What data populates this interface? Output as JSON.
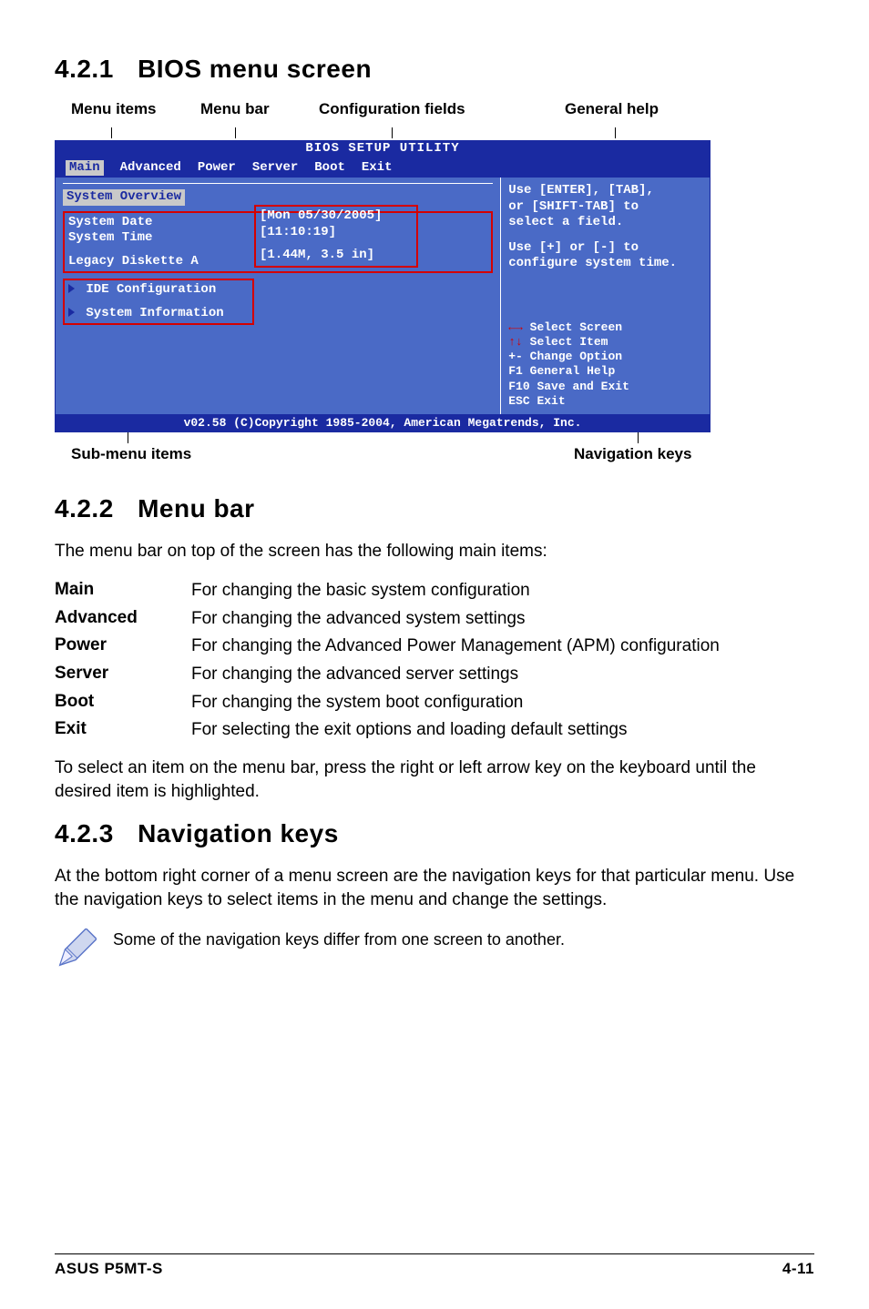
{
  "sections": {
    "s1": {
      "num": "4.2.1",
      "title": "BIOS menu screen"
    },
    "s2": {
      "num": "4.2.2",
      "title": "Menu bar"
    },
    "s3": {
      "num": "4.2.3",
      "title": "Navigation keys"
    }
  },
  "annot": {
    "menu_items": "Menu items",
    "menu_bar": "Menu bar",
    "config_fields": "Configuration fields",
    "general_help": "General help",
    "sub_menu": "Sub-menu items",
    "nav_keys": "Navigation keys"
  },
  "bios": {
    "title": "BIOS SETUP UTILITY",
    "tabs": [
      "Main",
      "Advanced",
      "Power",
      "Server",
      "Boot",
      "Exit"
    ],
    "selected_tab": "Main",
    "overview": "System Overview",
    "fields": {
      "date_label": "System Date",
      "date_value": "[Mon 05/30/2005]",
      "time_label": "System Time",
      "time_value": "[11:10:19]",
      "legacy_label": "Legacy Diskette A",
      "legacy_value": "[1.44M, 3.5 in]"
    },
    "submenu": {
      "ide": "IDE Configuration",
      "sysinfo": "System Information"
    },
    "help": {
      "line1": "Use [ENTER], [TAB],",
      "line2": "or [SHIFT-TAB] to",
      "line3": "select a field.",
      "line4": "Use [+] or [-] to",
      "line5": "configure system time."
    },
    "nav": {
      "l1a": "←→",
      "l1b": "Select Screen",
      "l2a": "↑↓",
      "l2b": "Select Item",
      "l3a": "+-",
      "l3b": "Change Option",
      "l4a": "F1",
      "l4b": "General Help",
      "l5a": "F10",
      "l5b": "Save and Exit",
      "l6a": "ESC",
      "l6b": "Exit"
    },
    "footer": "v02.58 (C)Copyright 1985-2004, American Megatrends, Inc."
  },
  "menu_bar_intro": "The menu bar on top of the screen has the following main items:",
  "defs": [
    {
      "term": "Main",
      "desc": "For changing the basic system configuration"
    },
    {
      "term": "Advanced",
      "desc": "For changing the advanced system settings"
    },
    {
      "term": "Power",
      "desc": "For changing the Advanced Power Management (APM) configuration"
    },
    {
      "term": "Server",
      "desc": "For changing the advanced server settings"
    },
    {
      "term": "Boot",
      "desc": "For changing the system boot configuration"
    },
    {
      "term": "Exit",
      "desc": "For selecting the exit options and loading default settings"
    }
  ],
  "menu_bar_outro": "To select an item on the menu bar, press the right or left arrow key on the keyboard until the desired item is highlighted.",
  "nav_text": "At the bottom right corner of a menu screen are the navigation keys for that particular menu. Use the navigation keys to select items in the menu and change the settings.",
  "note": "Some of the navigation keys differ from one screen to another.",
  "footer": {
    "left": "ASUS P5MT-S",
    "right": "4-11"
  }
}
